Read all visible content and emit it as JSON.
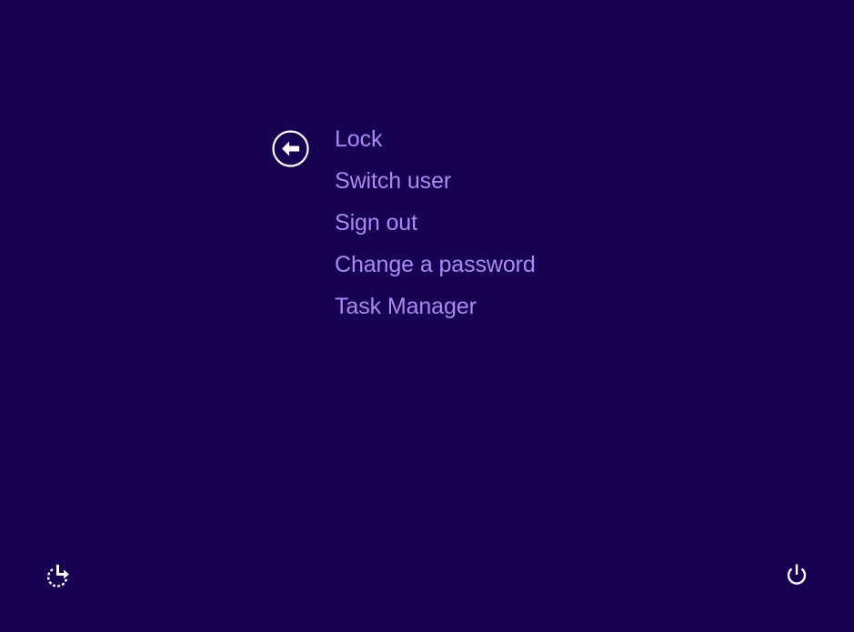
{
  "colors": {
    "background": "#180052",
    "menu_text": "#a88bf2",
    "icon": "#ffffff"
  },
  "back": {
    "icon": "back-arrow-icon"
  },
  "menu": {
    "items": [
      {
        "label": "Lock"
      },
      {
        "label": "Switch user"
      },
      {
        "label": "Sign out"
      },
      {
        "label": "Change a password"
      },
      {
        "label": "Task Manager"
      }
    ]
  },
  "footer": {
    "ease_of_access_icon": "ease-of-access-icon",
    "power_icon": "power-icon"
  }
}
